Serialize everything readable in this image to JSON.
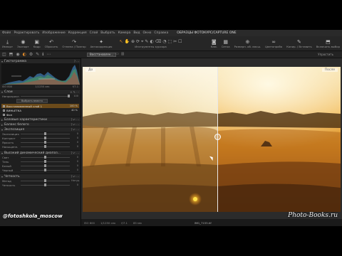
{
  "menubar": {
    "items": [
      "Файл",
      "Редактировать",
      "Изображение",
      "Коррекция",
      "Слой",
      "Выбрать",
      "Камера",
      "Вид",
      "Окно",
      "Справка"
    ],
    "title": "ОБРАЗЦЫ ФОТОКУРС/CAPTURE ONE"
  },
  "toolbar": {
    "left": [
      {
        "icon": "download-icon",
        "glyph": "⤓",
        "label": "Импорт"
      },
      {
        "icon": "camera-icon",
        "glyph": "◉",
        "label": "Экспорт"
      },
      {
        "icon": "crop-icon",
        "glyph": "▣",
        "label": "Кадр"
      },
      {
        "icon": "reset-icon",
        "glyph": "↶",
        "label": "Сбросить"
      },
      {
        "icon": "undo-icon",
        "glyph": "↷",
        "label": "Отмена / Повтор"
      },
      {
        "icon": "auto-adjust-icon",
        "glyph": "✦",
        "label": "Автокоррекция"
      }
    ],
    "cursors_label": "Инструменты курсора",
    "right": [
      {
        "icon": "camera-body-icon",
        "glyph": "◙",
        "label": "Кам."
      },
      {
        "icon": "grid-icon",
        "glyph": "▦",
        "label": "Сетка"
      },
      {
        "icon": "zoom-icon",
        "glyph": "⊕",
        "label": "Разверн. об. масш."
      },
      {
        "icon": "proofing-icon",
        "glyph": "∞",
        "label": "Цветопроба"
      },
      {
        "icon": "copy-icon",
        "glyph": "✎",
        "label": "Копир. / Вставить"
      },
      {
        "icon": "mode-icon",
        "glyph": "⬒",
        "label": "Включить выбор"
      }
    ]
  },
  "left_tabs": [
    "◫",
    "⬒",
    "◉",
    "◐",
    "⚙",
    "✎",
    "ℹ",
    "⋯"
  ],
  "viewbar": {
    "variant": "Восстановлен...",
    "right_label": "Упростить"
  },
  "histogram": {
    "title": "Гистограмма",
    "meta_left": "ISO 800",
    "meta_mid": "1/1250 сек",
    "meta_right": "f/7.1"
  },
  "layers": {
    "title": "Слои",
    "opacity_label": "Непрозрачн.",
    "opacity_value": "100",
    "button": "Выбрать вместо",
    "items": [
      {
        "name": "Восстановленный слой 1",
        "opacity": "100 %",
        "selected": true
      },
      {
        "name": "ВИНЬЕТКА",
        "opacity": "40 %",
        "selected": false
      },
      {
        "name": "Фон",
        "opacity": "",
        "selected": false
      }
    ]
  },
  "sections": {
    "base": "Базовые характеристики",
    "wb": "Баланс белого",
    "exposure": "Экспозиция",
    "hdr": "Высокий динамический диапаз...",
    "sharp": "Четкость"
  },
  "exposure_rows": [
    {
      "label": "Экспозиция",
      "value": "0"
    },
    {
      "label": "Контраст",
      "value": "0"
    },
    {
      "label": "Яркость",
      "value": "0"
    },
    {
      "label": "Насыщенн.",
      "value": "0"
    }
  ],
  "hdr_rows": [
    {
      "label": "Свет",
      "value": "0"
    },
    {
      "label": "Тень",
      "value": "0"
    },
    {
      "label": "Белый",
      "value": "0"
    },
    {
      "label": "Черный",
      "value": "0"
    }
  ],
  "sharp_rows": [
    {
      "label": "Метод",
      "value": "Натур."
    },
    {
      "label": "Четкость",
      "value": "0"
    }
  ],
  "photo": {
    "before_label": "До",
    "after_label": "После"
  },
  "status": {
    "iso": "ISO 800",
    "shutter": "1/1250 сек",
    "aperture": "f/7.1",
    "focal": "85 мм",
    "filename": "IMG_7155.tif"
  },
  "watermarks": {
    "left": "@fotoshkola_moscow",
    "right": "Photo-Books.ru"
  },
  "colors": {
    "accent": "#e08a2a",
    "selection": "#6b4a1a"
  }
}
